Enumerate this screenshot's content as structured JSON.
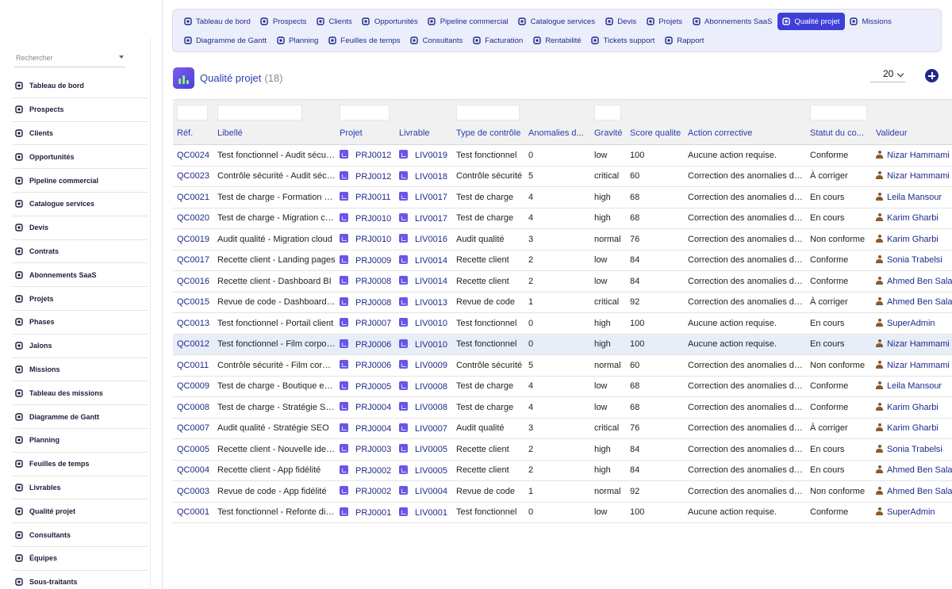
{
  "sidebar": {
    "search_placeholder": "Rechercher",
    "items": [
      {
        "label": "Tableau de bord",
        "icon": "dashboard-icon"
      },
      {
        "label": "Prospects",
        "icon": "user-plus-icon"
      },
      {
        "label": "Clients",
        "icon": "id-card-icon"
      },
      {
        "label": "Opportunités",
        "icon": "target-icon"
      },
      {
        "label": "Pipeline commercial",
        "icon": "bars-icon"
      },
      {
        "label": "Catalogue services",
        "icon": "tags-icon"
      },
      {
        "label": "Devis",
        "icon": "file-icon"
      },
      {
        "label": "Contrats",
        "icon": "contract-icon"
      },
      {
        "label": "Abonnements SaaS",
        "icon": "sync-icon"
      },
      {
        "label": "Projets",
        "icon": "project-diagram-icon"
      },
      {
        "label": "Phases",
        "icon": "layers-icon"
      },
      {
        "label": "Jalons",
        "icon": "flag-icon"
      },
      {
        "label": "Missions",
        "icon": "list-icon"
      },
      {
        "label": "Tableau des missions",
        "icon": "board-icon"
      },
      {
        "label": "Diagramme de Gantt",
        "icon": "gantt-icon"
      },
      {
        "label": "Planning",
        "icon": "calendar-icon"
      },
      {
        "label": "Feuilles de temps",
        "icon": "clock-icon"
      },
      {
        "label": "Livrables",
        "icon": "box-icon"
      },
      {
        "label": "Qualité projet",
        "icon": "clipboard-check-icon"
      },
      {
        "label": "Consultants",
        "icon": "user-icon"
      },
      {
        "label": "Équipes",
        "icon": "users-icon"
      },
      {
        "label": "Sous-traitants",
        "icon": "handshake-icon"
      }
    ]
  },
  "topnav": {
    "row1": [
      {
        "label": "Tableau de bord",
        "icon": "dashboard-icon",
        "active": false
      },
      {
        "label": "Prospects",
        "icon": "user-plus-icon",
        "active": false
      },
      {
        "label": "Clients",
        "icon": "id-card-icon",
        "active": false
      },
      {
        "label": "Opportunités",
        "icon": "target-icon",
        "active": false
      },
      {
        "label": "Pipeline commercial",
        "icon": "bars-icon",
        "active": false
      },
      {
        "label": "Catalogue services",
        "icon": "tags-icon",
        "active": false
      },
      {
        "label": "Devis",
        "icon": "file-icon",
        "active": false
      },
      {
        "label": "Projets",
        "icon": "project-diagram-icon",
        "active": false
      },
      {
        "label": "Abonnements SaaS",
        "icon": "sync-icon",
        "active": false
      },
      {
        "label": "Qualité projet",
        "icon": "clipboard-check-icon",
        "active": true
      },
      {
        "label": "Missions",
        "icon": "list-icon",
        "active": false
      }
    ],
    "row2": [
      {
        "label": "Diagramme de Gantt",
        "icon": "gantt-icon",
        "active": false
      },
      {
        "label": "Planning",
        "icon": "calendar-icon",
        "active": false
      },
      {
        "label": "Feuilles de temps",
        "icon": "clock-icon",
        "active": false
      },
      {
        "label": "Consultants",
        "icon": "user-icon",
        "active": false
      },
      {
        "label": "Facturation",
        "icon": "invoice-icon",
        "active": false
      },
      {
        "label": "Rentabilité",
        "icon": "chart-line-icon",
        "active": false
      },
      {
        "label": "Tickets support",
        "icon": "lifebuoy-icon",
        "active": false
      },
      {
        "label": "Rapport",
        "icon": "pie-chart-icon",
        "active": false
      }
    ]
  },
  "header": {
    "title": "Qualité projet",
    "count": "(18)",
    "limit": "20"
  },
  "table": {
    "columns": [
      "Réf.",
      "Libellé",
      "Projet",
      "Livrable",
      "Type de contrôle",
      "Anomalies d...",
      "Gravité",
      "Score qualite",
      "Action corrective",
      "Statut du co...",
      "Valideur"
    ],
    "rows": [
      {
        "ref": "QC0024",
        "libelle": "Test fonctionnel - Audit sécurité",
        "projet": "PRJ0012",
        "livrable": "LIV0019",
        "type": "Test fonctionnel",
        "anomalies": "0",
        "gravite": "low",
        "score": "100",
        "action": "Aucune action requise.",
        "statut": "Conforme",
        "valideur": "Nizar Hammami",
        "hl": false
      },
      {
        "ref": "QC0023",
        "libelle": "Contrôle sécurité - Audit sécurité",
        "projet": "PRJ0012",
        "livrable": "LIV0018",
        "type": "Contrôle sécurité",
        "anomalies": "5",
        "gravite": "critical",
        "score": "60",
        "action": "Correction des anomalies détectées",
        "statut": "À corriger",
        "valideur": "Nizar Hammami",
        "hl": false
      },
      {
        "ref": "QC0021",
        "libelle": "Test de charge - Formation en ligne",
        "projet": "PRJ0011",
        "livrable": "LIV0017",
        "type": "Test de charge",
        "anomalies": "4",
        "gravite": "high",
        "score": "68",
        "action": "Correction des anomalies détectées",
        "statut": "En cours",
        "valideur": "Leila Mansour",
        "hl": false
      },
      {
        "ref": "QC0020",
        "libelle": "Test de charge - Migration cloud",
        "projet": "PRJ0010",
        "livrable": "LIV0017",
        "type": "Test de charge",
        "anomalies": "4",
        "gravite": "high",
        "score": "68",
        "action": "Correction des anomalies détectées",
        "statut": "En cours",
        "valideur": "Karim Gharbi",
        "hl": false
      },
      {
        "ref": "QC0019",
        "libelle": "Audit qualité - Migration cloud",
        "projet": "PRJ0010",
        "livrable": "LIV0016",
        "type": "Audit qualité",
        "anomalies": "3",
        "gravite": "normal",
        "score": "76",
        "action": "Correction des anomalies détectées",
        "statut": "Non conforme",
        "valideur": "Karim Gharbi",
        "hl": false
      },
      {
        "ref": "QC0017",
        "libelle": "Recette client - Landing pages",
        "projet": "PRJ0009",
        "livrable": "LIV0014",
        "type": "Recette client",
        "anomalies": "2",
        "gravite": "low",
        "score": "84",
        "action": "Correction des anomalies détectées",
        "statut": "Conforme",
        "valideur": "Sonia Trabelsi",
        "hl": false
      },
      {
        "ref": "QC0016",
        "libelle": "Recette client - Dashboard BI",
        "projet": "PRJ0008",
        "livrable": "LIV0014",
        "type": "Recette client",
        "anomalies": "2",
        "gravite": "low",
        "score": "84",
        "action": "Correction des anomalies détectées",
        "statut": "Conforme",
        "valideur": "Ahmed Ben Salah",
        "hl": false
      },
      {
        "ref": "QC0015",
        "libelle": "Revue de code - Dashboard BI",
        "projet": "PRJ0008",
        "livrable": "LIV0013",
        "type": "Revue de code",
        "anomalies": "1",
        "gravite": "critical",
        "score": "92",
        "action": "Correction des anomalies détectées",
        "statut": "À corriger",
        "valideur": "Ahmed Ben Salah",
        "hl": false
      },
      {
        "ref": "QC0013",
        "libelle": "Test fonctionnel - Portail client",
        "projet": "PRJ0007",
        "livrable": "LIV0010",
        "type": "Test fonctionnel",
        "anomalies": "0",
        "gravite": "high",
        "score": "100",
        "action": "Aucune action requise.",
        "statut": "En cours",
        "valideur": "SuperAdmin",
        "hl": false
      },
      {
        "ref": "QC0012",
        "libelle": "Test fonctionnel - Film corporate",
        "projet": "PRJ0006",
        "livrable": "LIV0010",
        "type": "Test fonctionnel",
        "anomalies": "0",
        "gravite": "high",
        "score": "100",
        "action": "Aucune action requise.",
        "statut": "En cours",
        "valideur": "Nizar Hammami",
        "hl": true
      },
      {
        "ref": "QC0011",
        "libelle": "Contrôle sécurité - Film corporate",
        "projet": "PRJ0006",
        "livrable": "LIV0009",
        "type": "Contrôle sécurité",
        "anomalies": "5",
        "gravite": "normal",
        "score": "60",
        "action": "Correction des anomalies détectées",
        "statut": "Non conforme",
        "valideur": "Nizar Hammami",
        "hl": false
      },
      {
        "ref": "QC0009",
        "libelle": "Test de charge - Boutique en ligne",
        "projet": "PRJ0005",
        "livrable": "LIV0008",
        "type": "Test de charge",
        "anomalies": "4",
        "gravite": "low",
        "score": "68",
        "action": "Correction des anomalies détectées",
        "statut": "Conforme",
        "valideur": "Leila Mansour",
        "hl": false
      },
      {
        "ref": "QC0008",
        "libelle": "Test de charge - Stratégie SEO",
        "projet": "PRJ0004",
        "livrable": "LIV0008",
        "type": "Test de charge",
        "anomalies": "4",
        "gravite": "low",
        "score": "68",
        "action": "Correction des anomalies détectées",
        "statut": "Conforme",
        "valideur": "Karim Gharbi",
        "hl": false
      },
      {
        "ref": "QC0007",
        "libelle": "Audit qualité - Stratégie SEO",
        "projet": "PRJ0004",
        "livrable": "LIV0007",
        "type": "Audit qualité",
        "anomalies": "3",
        "gravite": "critical",
        "score": "76",
        "action": "Correction des anomalies détectées",
        "statut": "À corriger",
        "valideur": "Karim Gharbi",
        "hl": false
      },
      {
        "ref": "QC0005",
        "libelle": "Recette client - Nouvelle identité",
        "projet": "PRJ0003",
        "livrable": "LIV0005",
        "type": "Recette client",
        "anomalies": "2",
        "gravite": "high",
        "score": "84",
        "action": "Correction des anomalies détectées",
        "statut": "En cours",
        "valideur": "Sonia Trabelsi",
        "hl": false
      },
      {
        "ref": "QC0004",
        "libelle": "Recette client - App fidélité",
        "projet": "PRJ0002",
        "livrable": "LIV0005",
        "type": "Recette client",
        "anomalies": "2",
        "gravite": "high",
        "score": "84",
        "action": "Correction des anomalies détectées",
        "statut": "En cours",
        "valideur": "Ahmed Ben Salah",
        "hl": false
      },
      {
        "ref": "QC0003",
        "libelle": "Revue de code - App fidélité",
        "projet": "PRJ0002",
        "livrable": "LIV0004",
        "type": "Revue de code",
        "anomalies": "1",
        "gravite": "normal",
        "score": "92",
        "action": "Correction des anomalies détectées",
        "statut": "Non conforme",
        "valideur": "Ahmed Ben Salah",
        "hl": false
      },
      {
        "ref": "QC0001",
        "libelle": "Test fonctionnel - Refonte digitale",
        "projet": "PRJ0001",
        "livrable": "LIV0001",
        "type": "Test fonctionnel",
        "anomalies": "0",
        "gravite": "low",
        "score": "100",
        "action": "Aucune action requise.",
        "statut": "Conforme",
        "valideur": "SuperAdmin",
        "hl": false
      }
    ]
  }
}
